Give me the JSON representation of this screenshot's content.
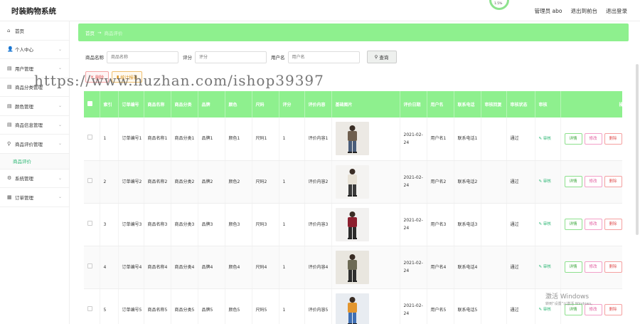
{
  "header": {
    "title": "时装购物系统",
    "badge_text": "1.5%",
    "user_label": "管理员 abo",
    "back_link": "退出到前台",
    "logout": "退出登录"
  },
  "sidebar": {
    "items": [
      {
        "icon": "home-icon",
        "glyph": "⌂",
        "label": "首页",
        "chevron": false
      },
      {
        "icon": "user-icon",
        "glyph": "👤",
        "label": "个人中心",
        "chevron": true
      },
      {
        "icon": "users-icon",
        "glyph": "▤",
        "label": "用户管理",
        "chevron": true
      },
      {
        "icon": "category-icon",
        "glyph": "▤",
        "label": "商品分类管理",
        "chevron": true
      },
      {
        "icon": "color-icon",
        "glyph": "▤",
        "label": "颜色管理",
        "chevron": true
      },
      {
        "icon": "product-icon",
        "glyph": "▤",
        "label": "商品信息管理",
        "chevron": true
      },
      {
        "icon": "review-icon",
        "glyph": "⚲",
        "label": "商品评价管理",
        "chevron": true
      }
    ],
    "sub_item": "商品评价",
    "items_after": [
      {
        "icon": "system-icon",
        "glyph": "⚙",
        "label": "系统管理",
        "chevron": true
      },
      {
        "icon": "order-icon",
        "glyph": "▦",
        "label": "订单管理",
        "chevron": true
      }
    ]
  },
  "breadcrumb": {
    "home": "首页",
    "sep": "→",
    "current": "商品评价"
  },
  "filters": [
    {
      "label": "商品名称",
      "placeholder": "商品名称"
    },
    {
      "label": "评分",
      "placeholder": "评分"
    },
    {
      "label": "用户名",
      "placeholder": "用户名"
    }
  ],
  "search_button": "查询",
  "actions": {
    "delete": "删除",
    "stats": "统计报表"
  },
  "watermark": "https://www.huzhan.com/ishop39397",
  "table": {
    "columns": [
      "",
      "索引",
      "订单编号",
      "商品名称",
      "商品分类",
      "品牌",
      "颜色",
      "尺码",
      "评分",
      "评价内容",
      "基础图片",
      "评价日期",
      "用户名",
      "联系电话",
      "审核回复",
      "审核状态",
      "审核",
      "操作"
    ],
    "rows": [
      {
        "index": "1",
        "order": "订单编号1",
        "name": "商品名称1",
        "category": "商品分类1",
        "brand": "品牌1",
        "color": "颜色1",
        "size": "尺码1",
        "score": "1",
        "content": "评价内容1",
        "date": "2021-02-24",
        "user": "用户名1",
        "phone": "联系电话1",
        "reply": "",
        "status": "通过",
        "audit": "审核"
      },
      {
        "index": "2",
        "order": "订单编号2",
        "name": "商品名称2",
        "category": "商品分类2",
        "brand": "品牌2",
        "color": "颜色2",
        "size": "尺码2",
        "score": "1",
        "content": "评价内容2",
        "date": "2021-02-24",
        "user": "用户名2",
        "phone": "联系电话2",
        "reply": "",
        "status": "通过",
        "audit": "审核"
      },
      {
        "index": "3",
        "order": "订单编号3",
        "name": "商品名称3",
        "category": "商品分类3",
        "brand": "品牌3",
        "color": "颜色3",
        "size": "尺码3",
        "score": "1",
        "content": "评价内容3",
        "date": "2021-02-24",
        "user": "用户名3",
        "phone": "联系电话3",
        "reply": "",
        "status": "通过",
        "audit": "审核"
      },
      {
        "index": "4",
        "order": "订单编号4",
        "name": "商品名称4",
        "category": "商品分类4",
        "brand": "品牌4",
        "color": "颜色4",
        "size": "尺码4",
        "score": "1",
        "content": "评价内容4",
        "date": "2021-02-24",
        "user": "用户名4",
        "phone": "联系电话4",
        "reply": "",
        "status": "通过",
        "audit": "审核"
      },
      {
        "index": "5",
        "order": "订单编号5",
        "name": "商品名称5",
        "category": "商品分类5",
        "brand": "品牌5",
        "color": "颜色5",
        "size": "尺码5",
        "score": "1",
        "content": "评价内容5",
        "date": "2021-02-24",
        "user": "用户名5",
        "phone": "联系电话5",
        "reply": "",
        "status": "通过",
        "audit": "审核"
      }
    ],
    "ops": {
      "detail": "详情",
      "edit": "修改",
      "delete": "删除"
    }
  },
  "os_overlay": {
    "line1": "激活 Windows",
    "line2": "转到“设置”以激活 Windows。"
  },
  "colors": {
    "accent": "#8ef08e",
    "audit": "#2bb673"
  }
}
